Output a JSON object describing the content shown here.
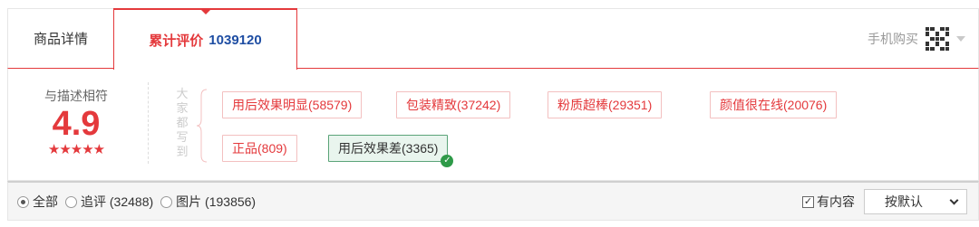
{
  "tabs": {
    "detail_label": "商品详情",
    "reviews_label": "累计评价",
    "reviews_count": "1039120",
    "mobile_buy_label": "手机购买"
  },
  "summary": {
    "title": "与描述相符",
    "score": "4.9",
    "stars": "★★★★★",
    "side_label": "大家都写到"
  },
  "tags": [
    {
      "text": "用后效果明显(58579)",
      "type": "positive"
    },
    {
      "text": "包装精致(37242)",
      "type": "positive"
    },
    {
      "text": "粉质超棒(29351)",
      "type": "positive"
    },
    {
      "text": "颜值很在线(20076)",
      "type": "positive"
    },
    {
      "text": "正品(809)",
      "type": "positive"
    },
    {
      "text": "用后效果差(3365)",
      "type": "negative",
      "selected": true
    }
  ],
  "filters": {
    "all_label": "全部",
    "followup_label": "追评 (32488)",
    "photos_label": "图片 (193856)",
    "selected": "全部"
  },
  "options": {
    "has_content_label": "有内容",
    "has_content_checked": true,
    "sort_label": "按默认"
  },
  "colors": {
    "accent": "#e4393c",
    "count_blue": "#1f4ea3",
    "negative_border": "#5aa478",
    "check_green": "#2e9a48"
  }
}
